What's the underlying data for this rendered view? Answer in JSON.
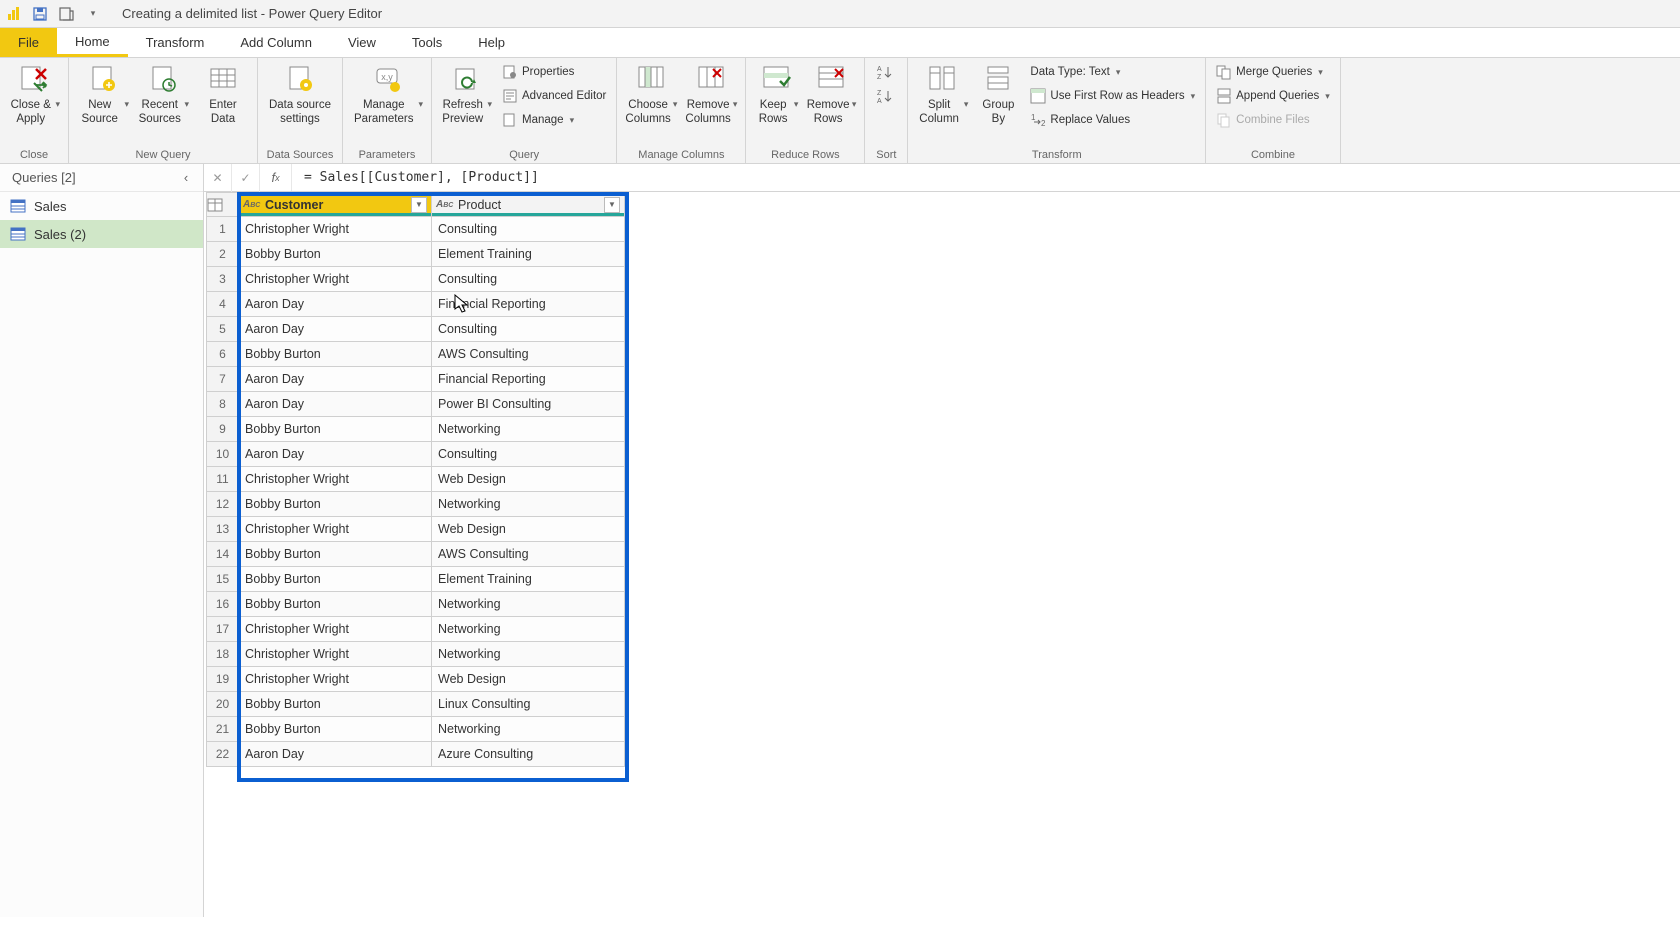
{
  "title": "Creating a delimited list - Power Query Editor",
  "tabs": {
    "file": "File",
    "home": "Home",
    "transform": "Transform",
    "add_column": "Add Column",
    "view": "View",
    "tools": "Tools",
    "help": "Help"
  },
  "ribbon": {
    "close_apply": "Close & Apply",
    "close_group": "Close",
    "new_source": "New Source",
    "recent_sources": "Recent Sources",
    "enter_data": "Enter Data",
    "new_query_group": "New Query",
    "data_source_settings": "Data source settings",
    "data_sources_group": "Data Sources",
    "manage_parameters": "Manage Parameters",
    "parameters_group": "Parameters",
    "refresh_preview": "Refresh Preview",
    "properties": "Properties",
    "advanced_editor": "Advanced Editor",
    "manage": "Manage",
    "query_group": "Query",
    "choose_columns": "Choose Columns",
    "remove_columns": "Remove Columns",
    "manage_columns_group": "Manage Columns",
    "keep_rows": "Keep Rows",
    "remove_rows": "Remove Rows",
    "reduce_rows_group": "Reduce Rows",
    "sort_group": "Sort",
    "split_column": "Split Column",
    "group_by": "Group By",
    "data_type": "Data Type: Text",
    "first_row_headers": "Use First Row as Headers",
    "replace_values": "Replace Values",
    "transform_group": "Transform",
    "merge_queries": "Merge Queries",
    "append_queries": "Append Queries",
    "combine_files": "Combine Files",
    "combine_group": "Combine"
  },
  "formula": "= Sales[[Customer], [Product]]",
  "queries": {
    "header": "Queries [2]",
    "items": [
      "Sales",
      "Sales (2)"
    ]
  },
  "columns": {
    "customer": "Customer",
    "product": "Product",
    "type_label": "ABC"
  },
  "rows": [
    {
      "n": "1",
      "customer": "Christopher Wright",
      "product": "Consulting"
    },
    {
      "n": "2",
      "customer": "Bobby Burton",
      "product": "Element Training"
    },
    {
      "n": "3",
      "customer": "Christopher Wright",
      "product": "Consulting"
    },
    {
      "n": "4",
      "customer": "Aaron Day",
      "product": "Financial Reporting"
    },
    {
      "n": "5",
      "customer": "Aaron Day",
      "product": "Consulting"
    },
    {
      "n": "6",
      "customer": "Bobby Burton",
      "product": "AWS Consulting"
    },
    {
      "n": "7",
      "customer": "Aaron Day",
      "product": "Financial Reporting"
    },
    {
      "n": "8",
      "customer": "Aaron Day",
      "product": "Power BI Consulting"
    },
    {
      "n": "9",
      "customer": "Bobby Burton",
      "product": "Networking"
    },
    {
      "n": "10",
      "customer": "Aaron Day",
      "product": "Consulting"
    },
    {
      "n": "11",
      "customer": "Christopher Wright",
      "product": "Web Design"
    },
    {
      "n": "12",
      "customer": "Bobby Burton",
      "product": "Networking"
    },
    {
      "n": "13",
      "customer": "Christopher Wright",
      "product": "Web Design"
    },
    {
      "n": "14",
      "customer": "Bobby Burton",
      "product": "AWS Consulting"
    },
    {
      "n": "15",
      "customer": "Bobby Burton",
      "product": "Element Training"
    },
    {
      "n": "16",
      "customer": "Bobby Burton",
      "product": "Networking"
    },
    {
      "n": "17",
      "customer": "Christopher Wright",
      "product": "Networking"
    },
    {
      "n": "18",
      "customer": "Christopher Wright",
      "product": "Networking"
    },
    {
      "n": "19",
      "customer": "Christopher Wright",
      "product": "Web Design"
    },
    {
      "n": "20",
      "customer": "Bobby Burton",
      "product": "Linux Consulting"
    },
    {
      "n": "21",
      "customer": "Bobby Burton",
      "product": "Networking"
    },
    {
      "n": "22",
      "customer": "Aaron Day",
      "product": "Azure Consulting"
    }
  ]
}
